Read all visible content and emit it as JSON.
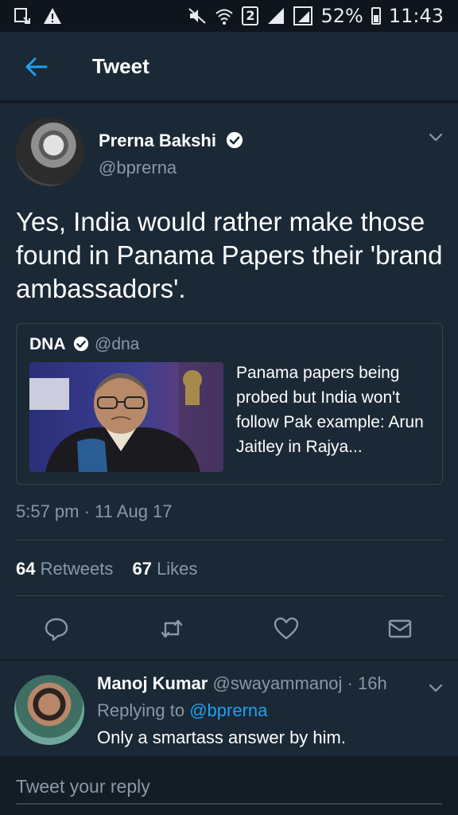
{
  "status_bar": {
    "sim_label": "2",
    "battery": "52%",
    "time": "11:43"
  },
  "app_bar": {
    "title": "Tweet"
  },
  "tweet": {
    "author_name": "Prerna Bakshi",
    "author_handle": "@bprerna",
    "text": "Yes, India would rather make those found in Panama Papers their 'brand ambassadors'.",
    "quoted": {
      "name": "DNA",
      "handle": "@dna",
      "text": "Panama papers being probed but India won't follow Pak example: Arun Jaitley in Rajya..."
    },
    "timestamp": "5:57 pm · 11 Aug 17",
    "retweets_count": "64",
    "retweets_label": "Retweets",
    "likes_count": "67",
    "likes_label": "Likes"
  },
  "reply": {
    "author_name": "Manoj Kumar",
    "author_handle": "@swayammanoj · 16h",
    "replying_prefix": "Replying to",
    "replying_to": "@bprerna",
    "text": "Only a smartass answer by him."
  },
  "compose": {
    "placeholder": "Tweet your reply"
  },
  "colors": {
    "accent": "#1da1f2",
    "background": "#141d26",
    "card": "#1b2836",
    "secondary_text": "#8899a6"
  }
}
